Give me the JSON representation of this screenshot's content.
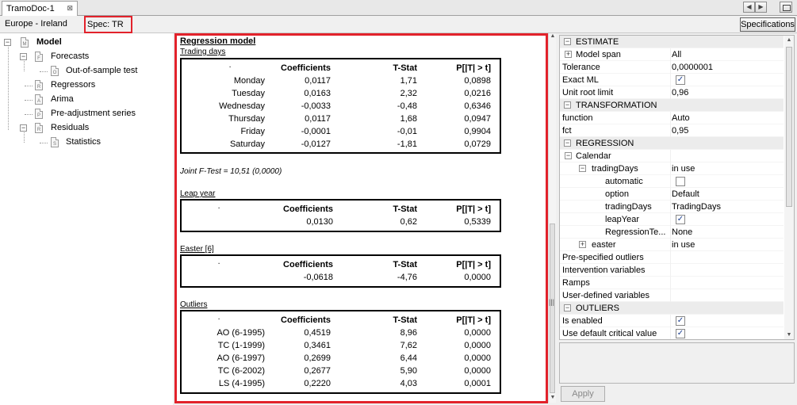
{
  "tab": {
    "title": "TramoDoc-1",
    "close": "⊠"
  },
  "window_controls": {
    "prev": "◀",
    "next": "▶"
  },
  "toolbar": {
    "location": "Europe - Ireland",
    "spec": "Spec: TR",
    "specifications_button": "Specifications"
  },
  "tree": {
    "model": "Model",
    "forecasts": "Forecasts",
    "oos": "Out-of-sample test",
    "regressors": "Regressors",
    "arima": "Arima",
    "preadj": "Pre-adjustment series",
    "residuals": "Residuals",
    "statistics": "Statistics",
    "icon_letters": {
      "model": "M",
      "forecasts": "F",
      "oos": "O",
      "regressors": "R",
      "arima": "A",
      "preadj": "P",
      "residuals": "R",
      "statistics": "S"
    },
    "expander_minus": "−"
  },
  "report": {
    "title": "Regression model",
    "headers": {
      "coef": "Coefficients",
      "tstat": "T-Stat",
      "pval": "P[|T| > t]"
    },
    "trading_days": {
      "title": "Trading days",
      "rows": [
        {
          "name": "Monday",
          "coef": "0,0117",
          "tstat": "1,71",
          "pval": "0,0898"
        },
        {
          "name": "Tuesday",
          "coef": "0,0163",
          "tstat": "2,32",
          "pval": "0,0216"
        },
        {
          "name": "Wednesday",
          "coef": "-0,0033",
          "tstat": "-0,48",
          "pval": "0,6346"
        },
        {
          "name": "Thursday",
          "coef": "0,0117",
          "tstat": "1,68",
          "pval": "0,0947"
        },
        {
          "name": "Friday",
          "coef": "-0,0001",
          "tstat": "-0,01",
          "pval": "0,9904"
        },
        {
          "name": "Saturday",
          "coef": "-0,0127",
          "tstat": "-1,81",
          "pval": "0,0729"
        }
      ]
    },
    "joint_ftest": "Joint F-Test = 10,51 (0,0000)",
    "leap_year": {
      "title": "Leap year",
      "coef": "0,0130",
      "tstat": "0,62",
      "pval": "0,5339"
    },
    "easter": {
      "title": "Easter [6]",
      "coef": "-0,0618",
      "tstat": "-4,76",
      "pval": "0,0000"
    },
    "outliers": {
      "title": "Outliers",
      "rows": [
        {
          "name": "AO (6-1995)",
          "coef": "0,4519",
          "tstat": "8,96",
          "pval": "0,0000"
        },
        {
          "name": "TC (1-1999)",
          "coef": "0,3461",
          "tstat": "7,62",
          "pval": "0,0000"
        },
        {
          "name": "AO (6-1997)",
          "coef": "0,2699",
          "tstat": "6,44",
          "pval": "0,0000"
        },
        {
          "name": "TC (6-2002)",
          "coef": "0,2677",
          "tstat": "5,90",
          "pval": "0,0000"
        },
        {
          "name": "LS (4-1995)",
          "coef": "0,2220",
          "tstat": "4,03",
          "pval": "0,0001"
        }
      ]
    },
    "dot": "."
  },
  "props": {
    "rows": [
      {
        "k": "ESTIMATE",
        "cat": true,
        "exp": "−"
      },
      {
        "k": "Model span",
        "v": "All",
        "exp": "+",
        "ind": 1
      },
      {
        "k": "Tolerance",
        "v": "0,0000001"
      },
      {
        "k": "Exact ML",
        "check": "✓"
      },
      {
        "k": "Unit root limit",
        "v": "0,96"
      },
      {
        "k": "TRANSFORMATION",
        "cat": true,
        "exp": "−"
      },
      {
        "k": "function",
        "v": "Auto"
      },
      {
        "k": "fct",
        "v": "0,95"
      },
      {
        "k": "REGRESSION",
        "cat": true,
        "exp": "−"
      },
      {
        "k": "Calendar",
        "exp": "−",
        "ind": 0
      },
      {
        "k": "tradingDays",
        "v": "in use",
        "exp": "−",
        "ind": 2
      },
      {
        "k": "automatic",
        "check": "",
        "ind": 3
      },
      {
        "k": "option",
        "v": "Default",
        "ind": 3
      },
      {
        "k": "tradingDays",
        "v": "TradingDays",
        "ind": 3
      },
      {
        "k": "leapYear",
        "check": "✓",
        "ind": 3
      },
      {
        "k": "RegressionTe...",
        "v": "None",
        "ind": 3
      },
      {
        "k": "easter",
        "v": "in use",
        "exp": "+",
        "ind": 2
      },
      {
        "k": "Pre-specified outliers"
      },
      {
        "k": "Intervention variables"
      },
      {
        "k": "Ramps"
      },
      {
        "k": "User-defined variables"
      },
      {
        "k": "OUTLIERS",
        "cat": true,
        "exp": "−"
      },
      {
        "k": "Is enabled",
        "check": "✓"
      },
      {
        "k": "Use default critical value",
        "check": "✓"
      }
    ],
    "apply_label": "Apply"
  },
  "scroll": {
    "up": "▲",
    "down": "▼"
  },
  "grip": "|||"
}
